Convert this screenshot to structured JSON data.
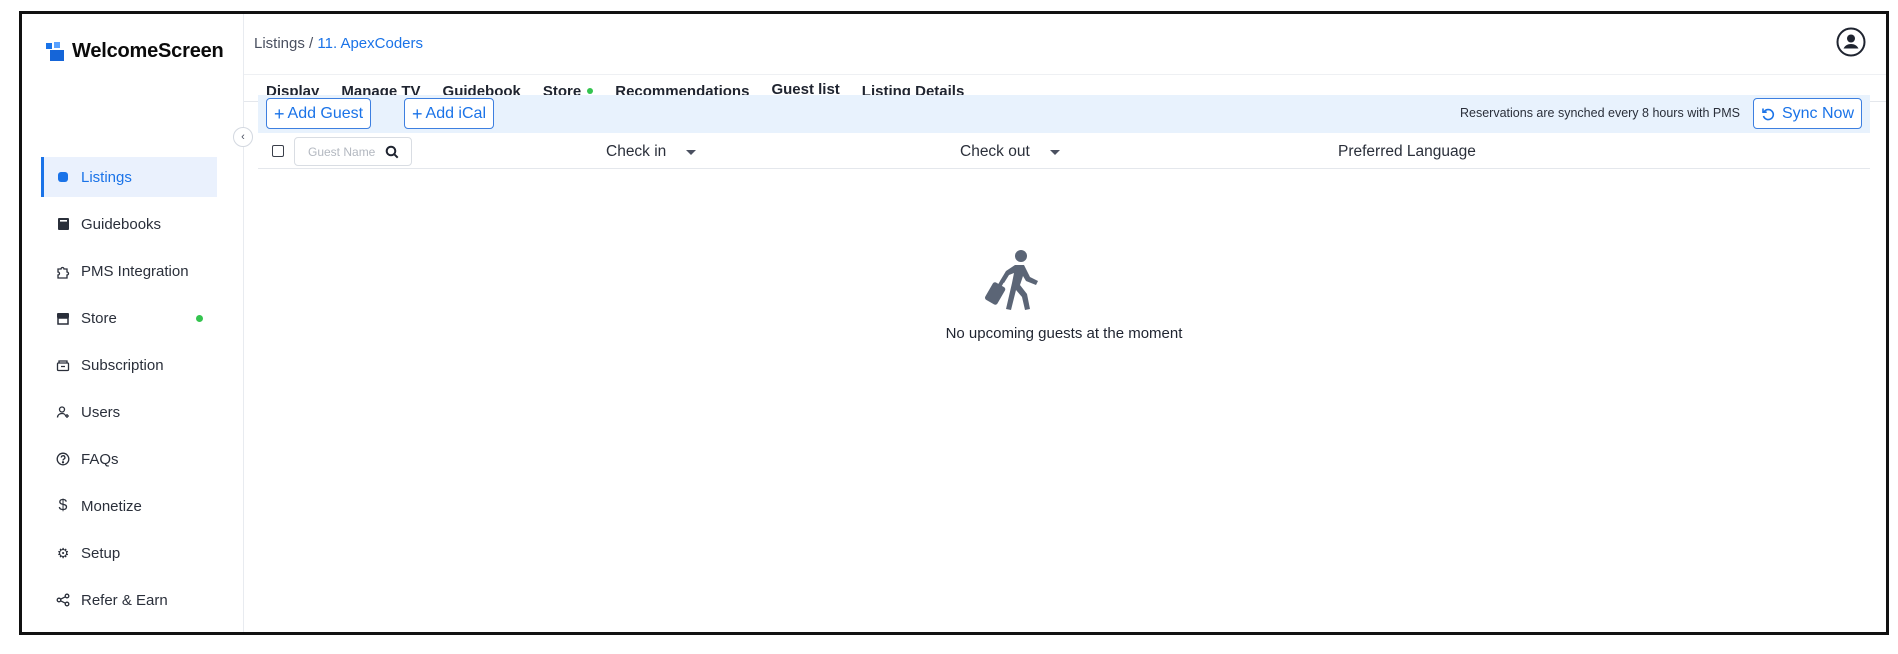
{
  "app": {
    "brand_name": "WelcomeScreen",
    "accent_color": "#1a73e8",
    "status_dot_color": "#34c44f"
  },
  "sidebar": {
    "collapse_icon": "chevron-left-icon",
    "items": [
      {
        "label": "Listings",
        "icon": "listings-icon",
        "active": true
      },
      {
        "label": "Guidebooks",
        "icon": "book-icon"
      },
      {
        "label": "PMS Integration",
        "icon": "puzzle-icon"
      },
      {
        "label": "Store",
        "icon": "store-icon",
        "status_dot": true
      },
      {
        "label": "Subscription",
        "icon": "subscription-icon"
      },
      {
        "label": "Users",
        "icon": "users-icon"
      },
      {
        "label": "FAQs",
        "icon": "question-icon"
      },
      {
        "label": "Monetize",
        "icon": "dollar-icon"
      },
      {
        "label": "Setup",
        "icon": "gear-icon"
      },
      {
        "label": "Refer & Earn",
        "icon": "share-icon"
      }
    ]
  },
  "header": {
    "breadcrumb_root": "Listings",
    "breadcrumb_sep": " / ",
    "breadcrumb_current": "11. ApexCoders",
    "avatar_icon": "user-avatar-icon"
  },
  "tabs": [
    {
      "label": "Display"
    },
    {
      "label": "Manage TV"
    },
    {
      "label": "Guidebook"
    },
    {
      "label": "Store",
      "status_dot": true
    },
    {
      "label": "Recommendations"
    },
    {
      "label": "Guest list",
      "active": true
    },
    {
      "label": "Listing Details"
    }
  ],
  "toolbar": {
    "add_guest_label": "Add Guest",
    "add_ical_label": "Add iCal",
    "sync_note": "Reservations are synched every 8 hours with PMS",
    "sync_label": "Sync Now"
  },
  "table": {
    "search_placeholder": "Guest Name",
    "columns": {
      "check_in": "Check in",
      "check_out": "Check out",
      "preferred_language": "Preferred Language"
    }
  },
  "empty_state": {
    "icon": "traveler-with-luggage-icon",
    "message": "No upcoming guests at the moment"
  }
}
